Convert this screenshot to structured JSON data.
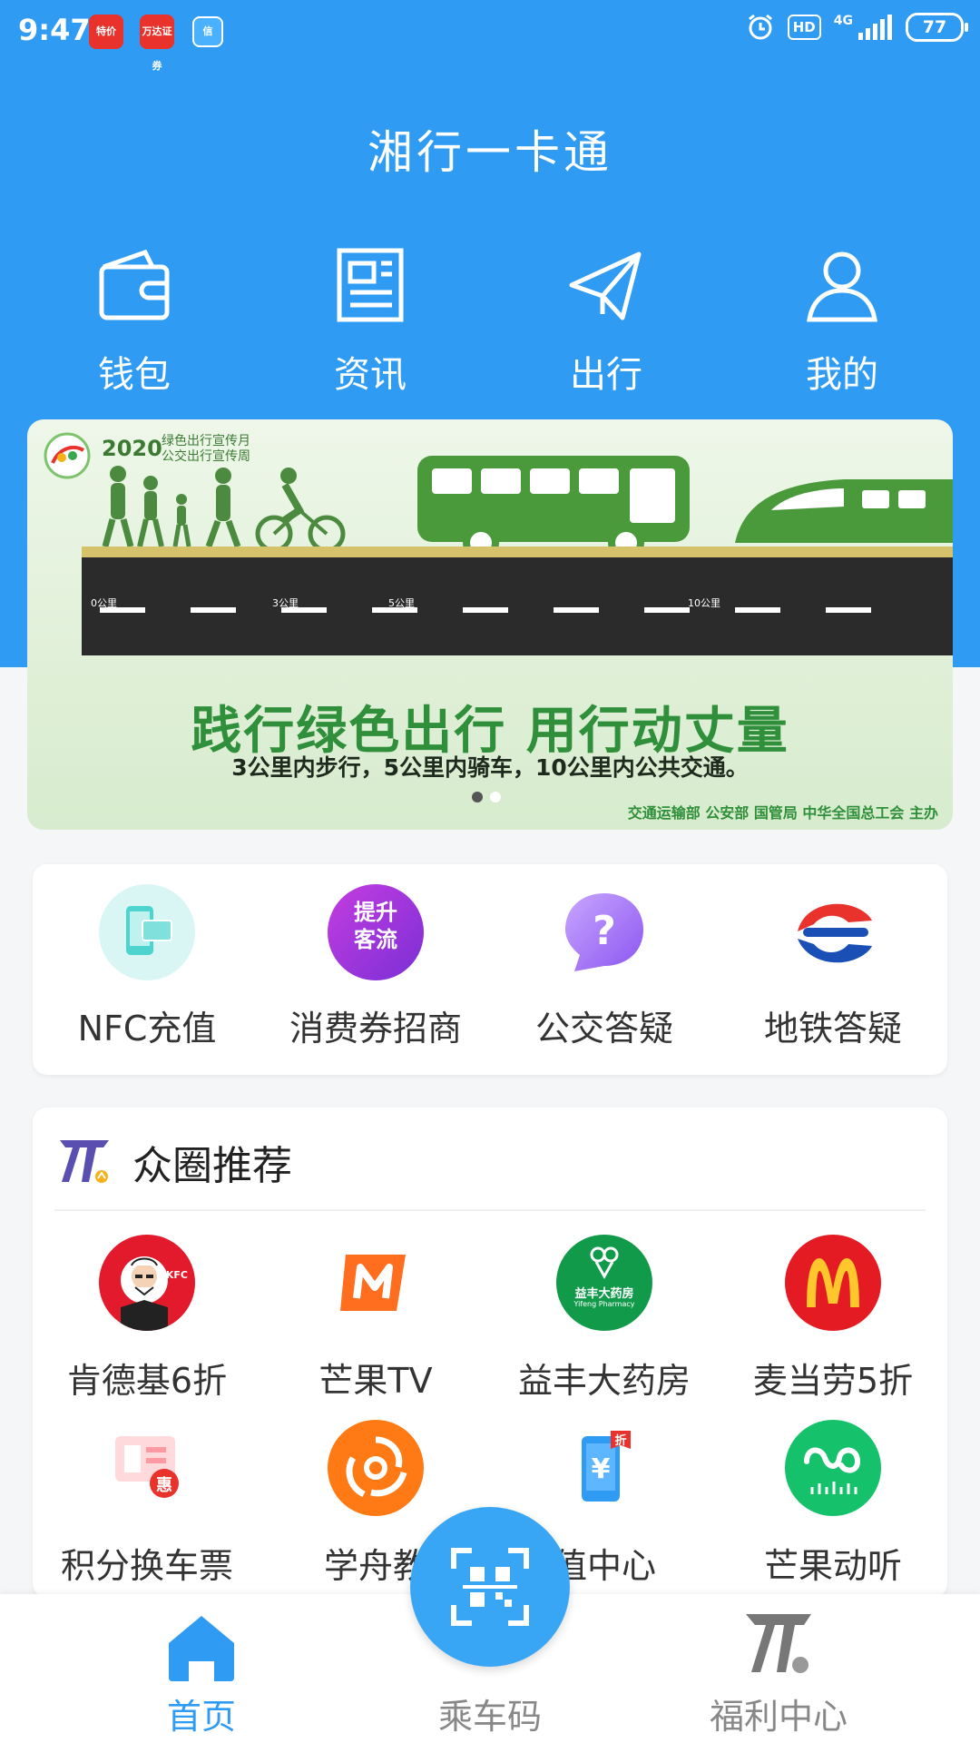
{
  "status_bar": {
    "time": "9:47",
    "apps": [
      "特价",
      "万达证券",
      "信"
    ],
    "hd": "HD",
    "network": "4G",
    "battery": "77"
  },
  "app_title": "湘行一卡通",
  "top_nav": [
    {
      "label": "钱包",
      "icon": "wallet-icon"
    },
    {
      "label": "资讯",
      "icon": "news-icon"
    },
    {
      "label": "出行",
      "icon": "paper-plane-icon"
    },
    {
      "label": "我的",
      "icon": "user-icon"
    }
  ],
  "banner": {
    "year": "2020",
    "sub_line1": "绿色出行宣传月",
    "sub_line2": "公交出行宣传周",
    "road_labels": [
      "0公里",
      "3公里",
      "5公里",
      "10公里"
    ],
    "headline": "践行绿色出行  用行动丈量",
    "subline": "3公里内步行，5公里内骑车，10公里内公共交通。",
    "sponsor": "交通运输部  公安部  国管局  中华全国总工会  主办",
    "slide_count": 2,
    "active_slide": 1
  },
  "quick_services": [
    {
      "label": "NFC充值",
      "icon": "nfc-phone-icon"
    },
    {
      "label": "消费券招商",
      "icon": "boost-traffic-icon",
      "icon_text": [
        "提升",
        "客流"
      ]
    },
    {
      "label": "公交答疑",
      "icon": "question-bubble-icon"
    },
    {
      "label": "地铁答疑",
      "icon": "metro-logo-icon"
    }
  ],
  "recommend": {
    "title": "众圈推荐",
    "items": [
      {
        "label": "肯德基6折",
        "icon": "kfc-logo-icon",
        "icon_text": "KFC"
      },
      {
        "label": "芒果TV",
        "icon": "mango-tv-logo-icon"
      },
      {
        "label": "益丰大药房",
        "icon": "yifeng-pharmacy-logo-icon",
        "icon_text": "益丰大药房",
        "icon_subtext": "Yifeng Pharmacy"
      },
      {
        "label": "麦当劳5折",
        "icon": "mcdonalds-logo-icon"
      },
      {
        "label": "积分换车票",
        "icon": "ticket-exchange-icon",
        "icon_text": "惠"
      },
      {
        "label": "学舟教",
        "icon": "xuezhou-logo-icon"
      },
      {
        "label": "值中心",
        "icon": "recharge-phone-icon",
        "icon_text": "折"
      },
      {
        "label": "芒果动听",
        "icon": "mango-music-logo-icon"
      }
    ]
  },
  "bottom_nav": [
    {
      "label": "首页",
      "icon": "home-icon",
      "active": true
    },
    {
      "label": "乘车码",
      "icon": "qr-scan-icon",
      "active": false
    },
    {
      "label": "福利中心",
      "icon": "welfare-logo-icon",
      "active": false
    }
  ],
  "colors": {
    "primary": "#2f9bf3",
    "banner_green": "#2f8f3a",
    "active_nav": "#2f9bf3",
    "inactive_nav": "#888888"
  }
}
